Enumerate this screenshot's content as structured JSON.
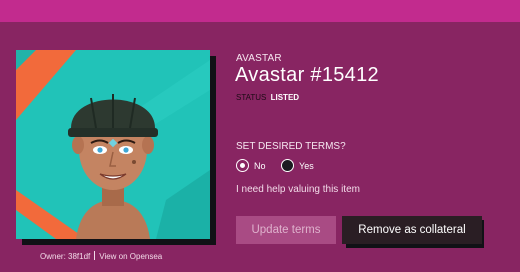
{
  "banner": {
    "text": ""
  },
  "nft": {
    "collection": "AVASTAR",
    "title": "Avastar #15412",
    "status_key": "STATUS",
    "status_value": "LISTED",
    "owner_label": "Owner: 38f1df",
    "opensea_link": "View on Opensea"
  },
  "terms": {
    "question": "SET DESIRED TERMS?",
    "options": [
      {
        "label": "No",
        "selected": true
      },
      {
        "label": "Yes",
        "selected": false
      }
    ],
    "help_link": "I need help valuing this item"
  },
  "actions": {
    "update_label": "Update terms",
    "remove_label": "Remove as collateral"
  },
  "colors": {
    "background": "#882562",
    "banner": "#c22b8e",
    "art_background": "#21c3b8",
    "update_button": "#a94b84",
    "remove_button": "#2a1e24"
  }
}
